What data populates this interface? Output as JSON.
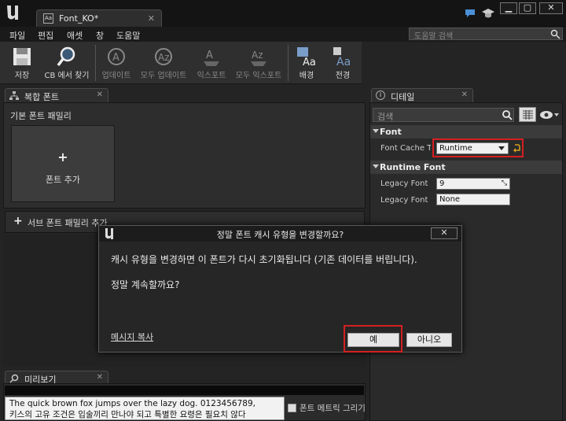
{
  "app": {
    "tab_title": "Font_KO*",
    "tab_icon_label": "Aa"
  },
  "menu": {
    "items": [
      "파일",
      "편집",
      "애셋",
      "창",
      "도움말"
    ],
    "help_search_placeholder": "도움말 검색"
  },
  "toolbar": {
    "buttons": [
      {
        "label": "저장",
        "icon": "save-icon"
      },
      {
        "label": "CB 에서 찾기",
        "icon": "magnifier-icon"
      },
      {
        "label": "업데이트",
        "icon": "update-icon"
      },
      {
        "label": "모두 업데이트",
        "icon": "update-all-icon"
      },
      {
        "label": "익스포트",
        "icon": "export-icon"
      },
      {
        "label": "모두 익스포트",
        "icon": "export-all-icon"
      },
      {
        "label": "배경",
        "icon": "background-icon"
      },
      {
        "label": "전경",
        "icon": "foreground-icon"
      }
    ]
  },
  "composite_panel": {
    "tab_label": "복합 폰트",
    "default_family_label": "기본 폰트 패밀리",
    "add_font_label": "폰트 추가",
    "sub_family_label": "서브 폰트 패밀리 추가"
  },
  "details_panel": {
    "tab_label": "디테일",
    "search_placeholder": "검색",
    "categories": [
      {
        "name": "Font",
        "properties": [
          {
            "label": "Font Cache Typ",
            "value": "Runtime"
          }
        ]
      },
      {
        "name": "Runtime Font",
        "properties": [
          {
            "label": "Legacy Font Si",
            "value": "9"
          },
          {
            "label": "Legacy Font N",
            "value": "None"
          }
        ]
      }
    ]
  },
  "preview": {
    "tab_label": "미리보기",
    "text_line1": "The quick brown fox jumps over the lazy dog. 0123456789,",
    "text_line2": "키스의 고유 조건은 입술끼리 만나야 되고 특별한 요령은 필요치 않다",
    "metrics_checkbox_label": "폰트 메트릭 그리기"
  },
  "dialog": {
    "title": "정말 폰트 캐시 유형을 변경할까요?",
    "message": "캐시 유형을 변경하면 이 폰트가 다시 초기화됩니다 (기존 데이터를 버립니다).",
    "question": "정말 계속할까요?",
    "copy_message_label": "메시지 복사",
    "yes_label": "예",
    "no_label": "아니오"
  },
  "colors": {
    "highlight": "#d52020",
    "background": "#242424"
  }
}
